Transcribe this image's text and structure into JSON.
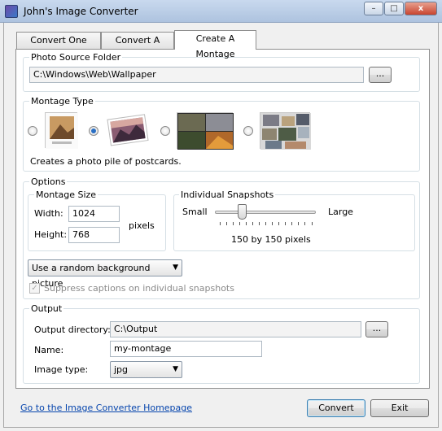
{
  "window": {
    "title": "John's Image Converter",
    "minimize": "–",
    "maximize": "□",
    "close": "x"
  },
  "tabs": [
    {
      "label": "Convert One Image"
    },
    {
      "label": "Convert A Folder"
    },
    {
      "label": "Create A Montage"
    }
  ],
  "photo_source": {
    "legend": "Photo Source Folder",
    "value": "C:\\Windows\\Web\\Wallpaper",
    "browse_label": "..."
  },
  "montage_type": {
    "legend": "Montage Type",
    "options": [
      {
        "icon": "postcard-single-icon",
        "selected": false
      },
      {
        "icon": "postcard-pile-icon",
        "selected": true
      },
      {
        "icon": "photo-grid-icon",
        "selected": false
      },
      {
        "icon": "photo-collage-icon",
        "selected": false
      }
    ],
    "description": "Creates a photo pile of postcards."
  },
  "options": {
    "legend": "Options",
    "size": {
      "legend": "Montage Size",
      "width_label": "Width:",
      "width_value": "1024",
      "height_label": "Height:",
      "height_value": "768",
      "units": "pixels"
    },
    "snapshots": {
      "legend": "Individual Snapshots",
      "small_label": "Small",
      "large_label": "Large",
      "value_text": "150 by 150 pixels",
      "slider_fraction": 0.25,
      "tick_count": 15
    },
    "background": {
      "selected": "Use a random background picture"
    },
    "suppress_captions": {
      "label": "Suppress captions on individual snapshots",
      "checked": true,
      "enabled": false
    }
  },
  "output": {
    "legend": "Output",
    "directory_label": "Output directory:",
    "directory_value": "C:\\Output",
    "browse_label": "...",
    "name_label": "Name:",
    "name_value": "my-montage",
    "type_label": "Image type:",
    "type_value": "jpg"
  },
  "footer": {
    "homepage_link": "Go to the Image Converter Homepage",
    "convert_label": "Convert",
    "exit_label": "Exit"
  },
  "colors": {
    "link": "#0645ad",
    "accent": "#2a6fc4"
  }
}
